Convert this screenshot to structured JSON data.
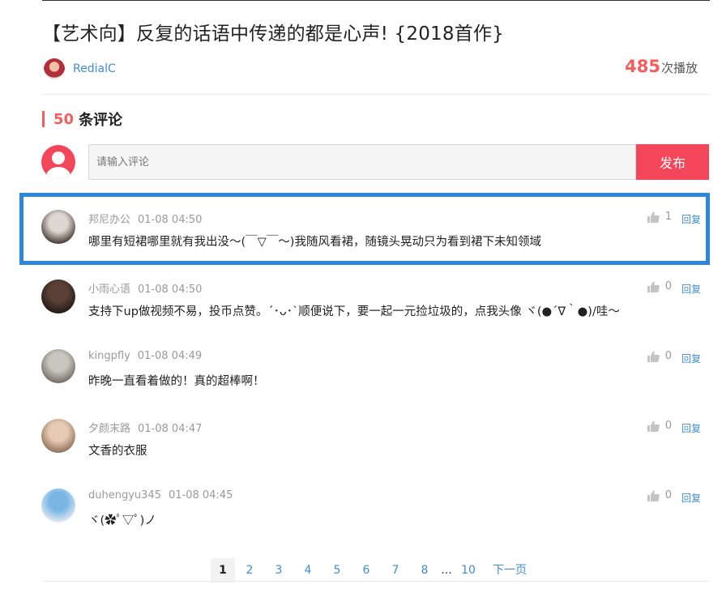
{
  "video": {
    "title": "【艺术向】反复的话语中传递的都是心声! {2018首作}",
    "author": "RedialC",
    "play_count": "485",
    "play_suffix": "次播放"
  },
  "comments_header": {
    "count": "50",
    "label": "条评论"
  },
  "composer": {
    "placeholder": "请输入评论",
    "submit_label": "发布"
  },
  "comments": [
    {
      "user": "邦尼办公",
      "time": "01-08 04:50",
      "text": "哪里有短裙哪里就有我出没～(￣▽￣～)我随风看裙，随镜头晃动只为看到裙下未知领域",
      "likes": "1",
      "reply_label": "回复",
      "avatar_colors": [
        "#ded6d0",
        "#3b2f2a"
      ]
    },
    {
      "user": "小雨心语",
      "time": "01-08 04:50",
      "text": "支持下up做视频不易，投币点赞。´･ᴗ･`顺便说下，要一起一元捡垃圾的，点我头像 ヾ(●´∇｀●)/哇～",
      "likes": "0",
      "reply_label": "回复",
      "avatar_colors": [
        "#5a4036",
        "#1f1713"
      ]
    },
    {
      "user": "kingpfly",
      "time": "01-08 04:49",
      "text": "昨晚一直看着做的！真的超棒啊！",
      "likes": "0",
      "reply_label": "回复",
      "avatar_colors": [
        "#c9c6c0",
        "#6c6660"
      ]
    },
    {
      "user": "夕颜末路",
      "time": "01-08 04:47",
      "text": "文香的衣服",
      "likes": "0",
      "reply_label": "回复",
      "avatar_colors": [
        "#e8cbb4",
        "#8a6a55"
      ]
    },
    {
      "user": "duhengyu345",
      "time": "01-08 04:45",
      "text": "ヾ(✿ﾟ▽ﾟ)ノ",
      "likes": "0",
      "reply_label": "回复",
      "avatar_colors": [
        "#79b6e6",
        "#e9eef2"
      ]
    }
  ],
  "pagination": {
    "pages": [
      "1",
      "2",
      "3",
      "4",
      "5",
      "6",
      "7",
      "8"
    ],
    "active": "1",
    "ellipsis": "...",
    "last": "10",
    "next_label": "下一页"
  },
  "colors": {
    "accent_red": "#f3465a",
    "link_blue": "#3e8ed0",
    "highlight_border": "#2d88dc"
  },
  "icons": {
    "like": "thumbs-up-icon",
    "default_avatar": "user-icon"
  }
}
